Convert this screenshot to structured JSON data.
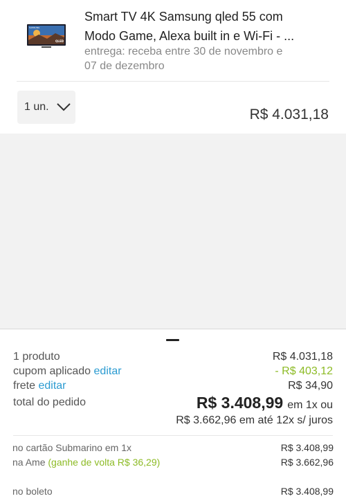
{
  "product": {
    "title_line1": "Smart TV 4K Samsung qled 55 com",
    "title_line2": "Modo Game, Alexa built in e Wi-Fi - ...",
    "delivery_line1": "entrega: receba entre 30 de novembro e",
    "delivery_line2": "07 de dezembro",
    "thumb_brand": "SAMSUNG",
    "thumb_badge": "QLED",
    "quantity": "1 un.",
    "price": "R$ 4.031,18"
  },
  "summary": {
    "items_label": "1 produto",
    "items_value": "R$ 4.031,18",
    "coupon_label": "cupom aplicado",
    "coupon_edit": "editar",
    "coupon_value": "- R$ 403,12",
    "shipping_label": "frete",
    "shipping_edit": "editar",
    "shipping_value": "R$ 34,90",
    "total_label": "total do pedido",
    "total_value": "R$ 3.408,99",
    "total_once": "em 1x ou",
    "installments": "R$ 3.662,96 em até 12x s/ juros"
  },
  "payments": {
    "card_label": "no cartão Submarino em 1x",
    "card_value": "R$ 3.408,99",
    "ame_label": "na Ame",
    "ame_cashback": "(ganhe de volta R$ 36,29)",
    "ame_value": "R$ 3.662,96",
    "boleto_label": "no boleto",
    "boleto_value": "R$ 3.408,99"
  },
  "colors": {
    "link": "#2b9bd1",
    "discount": "#8dbb26",
    "background_gray": "#f2f2f2"
  }
}
